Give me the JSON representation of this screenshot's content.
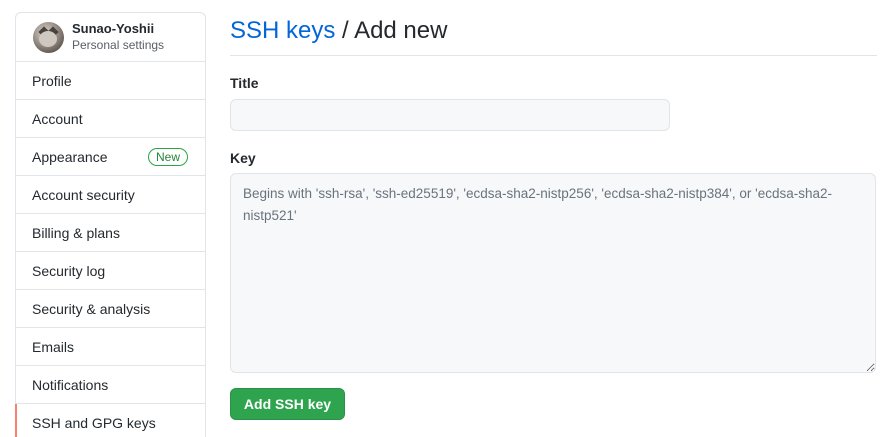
{
  "sidebar": {
    "profile": {
      "username": "Sunao-Yoshii",
      "subtitle": "Personal settings"
    },
    "items": [
      {
        "label": "Profile"
      },
      {
        "label": "Account"
      },
      {
        "label": "Appearance",
        "badge": "New"
      },
      {
        "label": "Account security"
      },
      {
        "label": "Billing & plans"
      },
      {
        "label": "Security log"
      },
      {
        "label": "Security & analysis"
      },
      {
        "label": "Emails"
      },
      {
        "label": "Notifications"
      },
      {
        "label": "SSH and GPG keys",
        "selected": true
      }
    ],
    "selected_accent": "#f9826c"
  },
  "header": {
    "crumb_link": "SSH keys",
    "separator": " / ",
    "current": "Add new"
  },
  "form": {
    "title_label": "Title",
    "title_value": "",
    "key_label": "Key",
    "key_value": "",
    "key_placeholder": "Begins with 'ssh-rsa', 'ssh-ed25519', 'ecdsa-sha2-nistp256', 'ecdsa-sha2-nistp384', or 'ecdsa-sha2-nistp521'",
    "submit_label": "Add SSH key"
  },
  "colors": {
    "link": "#0366d6",
    "primary_button": "#2ea44f",
    "badge_green": "#22863a"
  }
}
